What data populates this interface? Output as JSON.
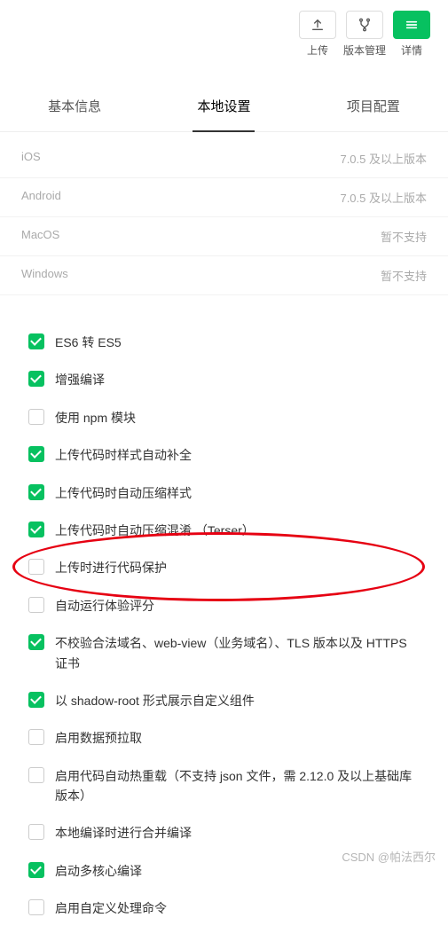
{
  "toolbar": {
    "upload": "上传",
    "version": "版本管理",
    "details": "详情"
  },
  "tabs": {
    "basic": "基本信息",
    "local": "本地设置",
    "project": "项目配置"
  },
  "platforms": [
    {
      "name": "iOS",
      "value": "7.0.5 及以上版本"
    },
    {
      "name": "Android",
      "value": "7.0.5 及以上版本"
    },
    {
      "name": "MacOS",
      "value": "暂不支持"
    },
    {
      "name": "Windows",
      "value": "暂不支持"
    }
  ],
  "options": [
    {
      "checked": true,
      "label": "ES6 转 ES5"
    },
    {
      "checked": true,
      "label": "增强编译"
    },
    {
      "checked": false,
      "label": "使用 npm 模块"
    },
    {
      "checked": true,
      "label": "上传代码时样式自动补全"
    },
    {
      "checked": true,
      "label": "上传代码时自动压缩样式"
    },
    {
      "checked": true,
      "label": "上传代码时自动压缩混淆 （Terser）"
    },
    {
      "checked": false,
      "label": "上传时进行代码保护"
    },
    {
      "checked": false,
      "label": "自动运行体验评分"
    },
    {
      "checked": true,
      "label": "不校验合法域名、web-view（业务域名）、TLS 版本以及 HTTPS 证书"
    },
    {
      "checked": true,
      "label": "以 shadow-root 形式展示自定义组件"
    },
    {
      "checked": false,
      "label": "启用数据预拉取"
    },
    {
      "checked": false,
      "label": "启用代码自动热重载（不支持 json 文件，需 2.12.0 及以上基础库版本）"
    },
    {
      "checked": false,
      "label": "本地编译时进行合并编译"
    },
    {
      "checked": true,
      "label": "启动多核心编译"
    },
    {
      "checked": false,
      "label": "启用自定义处理命令"
    }
  ],
  "watermark": "CSDN @帕法西尔"
}
